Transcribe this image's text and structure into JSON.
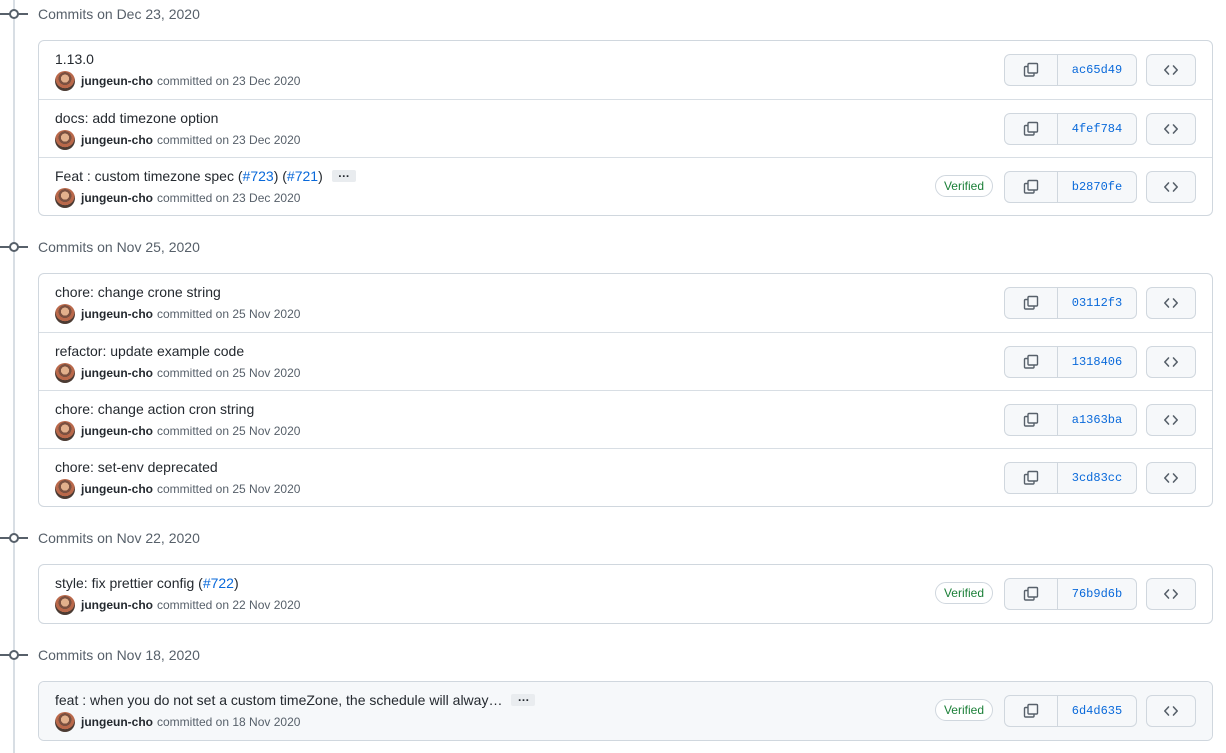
{
  "groups": [
    {
      "header": "Commits on Dec 23, 2020",
      "commits": [
        {
          "title": "1.13.0",
          "author": "jungeun-cho",
          "date": "committed on 23 Dec 2020",
          "sha": "ac65d49"
        },
        {
          "title": "docs: add timezone option",
          "author": "jungeun-cho",
          "date": "committed on 23 Dec 2020",
          "sha": "4fef784"
        },
        {
          "title_pre": "Feat : custom timezone spec (",
          "link1": "#723",
          "title_mid": ") (",
          "link2": "#721",
          "title_post": ")",
          "ellipsis": "…",
          "author": "jungeun-cho",
          "date": "committed on 23 Dec 2020",
          "sha": "b2870fe",
          "verified": "Verified"
        }
      ]
    },
    {
      "header": "Commits on Nov 25, 2020",
      "commits": [
        {
          "title": "chore: change crone string",
          "author": "jungeun-cho",
          "date": "committed on 25 Nov 2020",
          "sha": "03112f3"
        },
        {
          "title": "refactor: update example code",
          "author": "jungeun-cho",
          "date": "committed on 25 Nov 2020",
          "sha": "1318406"
        },
        {
          "title": "chore: change action cron string",
          "author": "jungeun-cho",
          "date": "committed on 25 Nov 2020",
          "sha": "a1363ba"
        },
        {
          "title": "chore: set-env deprecated",
          "author": "jungeun-cho",
          "date": "committed on 25 Nov 2020",
          "sha": "3cd83cc"
        }
      ]
    },
    {
      "header": "Commits on Nov 22, 2020",
      "commits": [
        {
          "title_pre": "style: fix prettier config (",
          "link1": "#722",
          "title_post": ")",
          "author": "jungeun-cho",
          "date": "committed on 22 Nov 2020",
          "sha": "76b9d6b",
          "verified": "Verified"
        }
      ]
    },
    {
      "header": "Commits on Nov 18, 2020",
      "commits": [
        {
          "title": "feat : when you do not set a custom timeZone, the schedule will alway…",
          "ellipsis": "…",
          "author": "jungeun-cho",
          "date": "committed on 18 Nov 2020",
          "sha": "6d4d635",
          "verified": "Verified"
        }
      ]
    }
  ],
  "icons": {
    "commit": "git-commit-icon",
    "copy": "copy-icon",
    "browse": "code-icon",
    "avatar": "user-avatar"
  },
  "colors": {
    "link": "#0969da",
    "verified": "#1a7f37",
    "border": "#d0d7de",
    "muted": "#57606a"
  }
}
